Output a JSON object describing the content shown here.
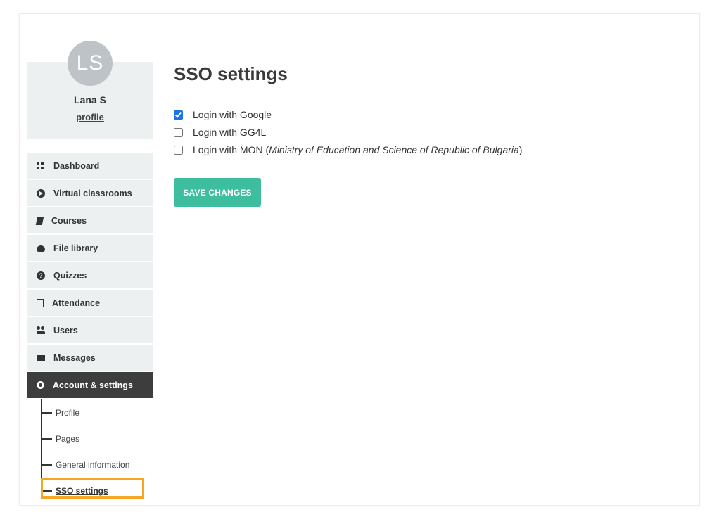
{
  "user": {
    "initials": "LS",
    "name": "Lana S",
    "profile_link": "profile"
  },
  "sidebar": {
    "items": [
      {
        "label": "Dashboard",
        "icon": "dashboard-icon"
      },
      {
        "label": "Virtual classrooms",
        "icon": "play-circle-icon"
      },
      {
        "label": "Courses",
        "icon": "book-icon"
      },
      {
        "label": "File library",
        "icon": "cloud-upload-icon"
      },
      {
        "label": "Quizzes",
        "icon": "question-circle-icon"
      },
      {
        "label": "Attendance",
        "icon": "document-icon"
      },
      {
        "label": "Users",
        "icon": "users-icon"
      },
      {
        "label": "Messages",
        "icon": "envelope-icon"
      },
      {
        "label": "Account & settings",
        "icon": "gear-icon",
        "active": true
      }
    ],
    "subitems": [
      {
        "label": "Profile"
      },
      {
        "label": "Pages"
      },
      {
        "label": "General information"
      },
      {
        "label": "SSO settings",
        "current": true
      }
    ]
  },
  "main": {
    "title": "SSO settings",
    "options": [
      {
        "label": "Login with Google",
        "checked": true
      },
      {
        "label": "Login with GG4L",
        "checked": false
      },
      {
        "label_prefix": "Login with MON (",
        "label_italic": "Ministry of Education and Science of Republic of Bulgaria",
        "label_suffix": ")",
        "checked": false
      }
    ],
    "save_label": "SAVE CHANGES"
  },
  "colors": {
    "accent": "#3dbf9f",
    "active_nav": "#3d3d3d",
    "nav_bg": "#ecf0f1",
    "highlight": "#f5a623"
  }
}
